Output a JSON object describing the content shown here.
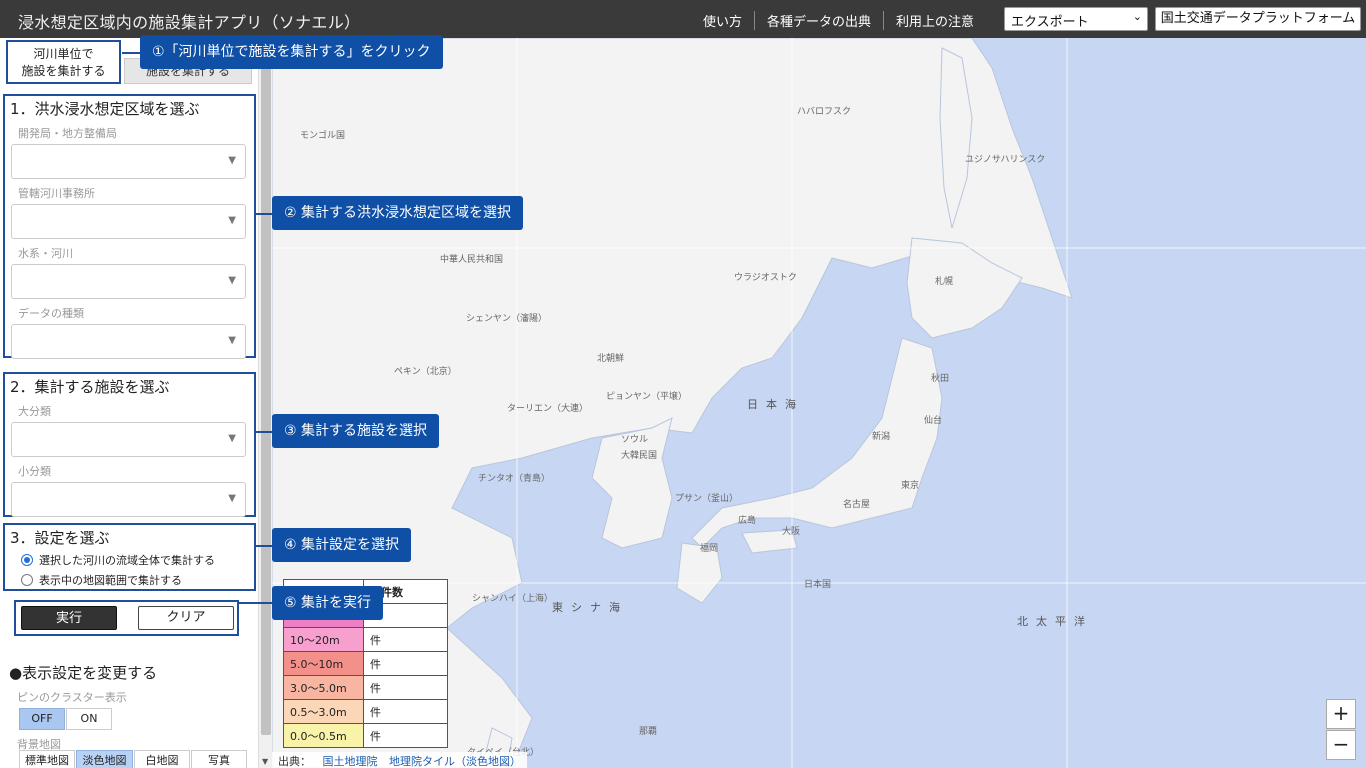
{
  "header": {
    "title": "浸水想定区域内の施設集計アプリ（ソナエル）",
    "nav": [
      "使い方",
      "各種データの出典",
      "利用上の注意"
    ],
    "export_label": "エクスポート",
    "platform_label": "国土交通データプラットフォーム"
  },
  "tabs": {
    "river_tab": [
      "河川単位で",
      "施設を集計する"
    ],
    "map_tab": "施設を集計する"
  },
  "step1": {
    "title": "1．洪水浸水想定区域を選ぶ",
    "fields": [
      "開発局・地方整備局",
      "管轄河川事務所",
      "水系・河川",
      "データの種類"
    ]
  },
  "step2": {
    "title": "2．集計する施設を選ぶ",
    "fields": [
      "大分類",
      "小分類"
    ]
  },
  "step3": {
    "title": "3．設定を選ぶ",
    "options": [
      "選択した河川の流域全体で集計する",
      "表示中の地図範囲で集計する"
    ],
    "selected": 0
  },
  "actions": {
    "run": "実行",
    "clear": "クリア"
  },
  "display": {
    "title": "●表示設定を変更する",
    "cluster_label": "ピンのクラスター表示",
    "cluster_off": "OFF",
    "cluster_on": "ON",
    "cluster_state": "OFF",
    "bg_label": "背景地図",
    "bg_options": [
      "標準地図",
      "淡色地図",
      "白地図",
      "写真"
    ],
    "bg_selected": "淡色地図"
  },
  "callouts": [
    "①「河川単位で施設を集計する」をクリック",
    "② 集計する洪水浸水想定区域を選択",
    "③ 集計する施設を選択",
    "④ 集計設定を選択",
    "⑤ 集計を実行"
  ],
  "legend": {
    "header_partial": "設件数",
    "rows": [
      {
        "range": "10〜20m",
        "count": "件",
        "color": "#f7a0d0"
      },
      {
        "range": "5.0〜10m",
        "count": "件",
        "color": "#f4908a"
      },
      {
        "range": "3.0〜5.0m",
        "count": "件",
        "color": "#f8b6a2"
      },
      {
        "range": "0.5〜3.0m",
        "count": "件",
        "color": "#fbd6b7"
      },
      {
        "range": "0.0〜0.5m",
        "count": "件",
        "color": "#f8f3a8"
      }
    ],
    "top_color": "#ee7fc4"
  },
  "map": {
    "places": [
      "ハバロフスク",
      "モンゴル国",
      "ユジノサハリンスク",
      "中華人民共和国",
      "ウラジオストク",
      "シェンヤン（瀋陽）",
      "北朝鮮",
      "ペキン（北京）",
      "ピョンヤン（平壌）",
      "ターリエン（大連）",
      "ソウル",
      "大韓民国",
      "チンタオ（青島）",
      "プサン（釜山）",
      "シャンハイ（上海）",
      "札幌",
      "仙台",
      "東京",
      "名古屋",
      "大阪",
      "福岡",
      "広島",
      "那覇",
      "新潟",
      "秋田",
      "タイペイ（台北）"
    ],
    "seas": [
      "日本海",
      "東シナ海",
      "北太平洋",
      "日本国"
    ],
    "zoom_in": "+",
    "zoom_out": "−"
  },
  "attribution": {
    "prefix": "出典：",
    "links": [
      "国土地理院",
      "地理院タイル（淡色地図）"
    ]
  }
}
